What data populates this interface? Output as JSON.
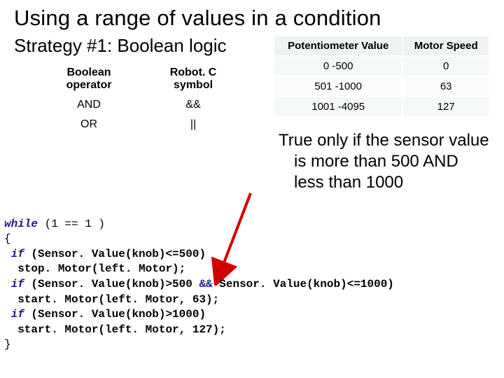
{
  "title": "Using a range of values in a condition",
  "subtitle": "Strategy #1: Boolean logic",
  "op_table": {
    "headers": [
      "Boolean operator",
      "Robot. C symbol"
    ],
    "rows": [
      {
        "op": "AND",
        "sym": "&&"
      },
      {
        "op": "OR",
        "sym": "||"
      }
    ]
  },
  "range_table": {
    "headers": [
      "Potentiometer Value",
      "Motor Speed"
    ],
    "rows": [
      {
        "range": "0 -500",
        "speed": "0"
      },
      {
        "range": "501 -1000",
        "speed": "63"
      },
      {
        "range": "1001 -4095",
        "speed": "127"
      }
    ]
  },
  "explain": "True only if the sensor value is more than 500 AND less than 1000",
  "code": {
    "l1a": "while",
    "l1b": " (1 == 1 )",
    "l2": "{",
    "l3a": "if",
    "l3b": " (Sensor. Value(knob)<=500)",
    "l4": "  stop. Motor(left. Motor);",
    "l5a": "if",
    "l5b": " (Sensor. Value(knob)>500 ",
    "l5c": "&&",
    "l5d": " Sensor. Value(knob)<=1000)",
    "l6": "  start. Motor(left. Motor, 63);",
    "l7a": "if",
    "l7b": " (Sensor. Value(knob)>1000)",
    "l8": "  start. Motor(left. Motor, 127);",
    "l9": "}"
  }
}
